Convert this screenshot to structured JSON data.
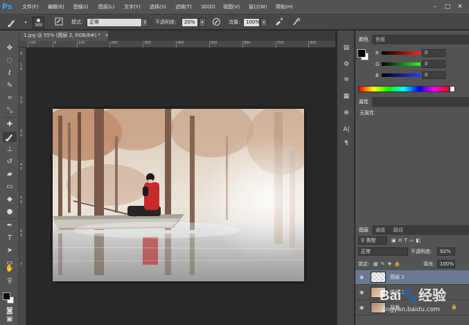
{
  "app": {
    "logo": "Ps",
    "accent": "#31a8ff"
  },
  "menu": {
    "items": [
      "文件(F)",
      "编辑(E)",
      "图像(I)",
      "图层(L)",
      "文字(Y)",
      "选择(S)",
      "滤镜(T)",
      "3D(D)",
      "视图(V)",
      "窗口(W)",
      "帮助(H)"
    ]
  },
  "window_controls": {
    "minimize": "–",
    "maximize": "□",
    "close": "✕"
  },
  "options": {
    "brush_size": "300",
    "mode_label": "模式:",
    "mode_value": "正常",
    "opacity_label": "不透明度:",
    "opacity_value": "20%",
    "flow_label": "流量:",
    "flow_value": "100%"
  },
  "document": {
    "tab_title": "1.jpg @ 55% (图层 2, RGB/8#) *",
    "tab_close": "×"
  },
  "ruler": {
    "h_labels": [
      "100",
      "0",
      "100",
      "200",
      "300",
      "400",
      "500",
      "600",
      "700",
      "800"
    ],
    "v_labels": [
      "0",
      "1",
      "0",
      "2",
      "0",
      "3",
      "0",
      "4",
      "0",
      "5",
      "0",
      "6",
      "0",
      "7"
    ]
  },
  "panels": {
    "color": {
      "tabs": [
        "颜色",
        "色板"
      ],
      "r_label": "R",
      "g_label": "G",
      "b_label": "B",
      "r_value": "0",
      "g_value": "0",
      "b_value": "0",
      "foreground": "#000000",
      "background": "#ffffff"
    },
    "properties": {
      "tab": "属性",
      "content": "无属性"
    },
    "layers": {
      "tabs": [
        "图层",
        "通道",
        "路径"
      ],
      "filter_value": "类型",
      "blend_mode": "正常",
      "opacity_label": "不透明度:",
      "opacity_value": "92%",
      "lock_label": "锁定:",
      "fill_label": "填充:",
      "fill_value": "100%",
      "rows": [
        {
          "name": "图层 2",
          "selected": true
        },
        {
          "name": "图层 1",
          "selected": false
        },
        {
          "name": "背景",
          "selected": false
        }
      ]
    }
  },
  "watermark": {
    "brand": "Bai",
    "brand2": "经验",
    "url": "jingyan.baidu.com"
  },
  "icons": {
    "brush": "brush-icon",
    "move": "move-icon",
    "marquee": "marquee-icon",
    "lasso": "lasso-icon",
    "quick_select": "quick-select-icon",
    "crop": "crop-icon",
    "eyedropper": "eyedropper-icon",
    "healing": "healing-icon",
    "stamp": "stamp-icon",
    "history": "history-brush-icon",
    "eraser": "eraser-icon",
    "gradient": "gradient-icon",
    "blur": "blur-icon",
    "dodge": "dodge-icon",
    "pen": "pen-icon",
    "type": "type-icon",
    "path_select": "path-select-icon",
    "shape": "rectangle-icon",
    "hand": "hand-icon",
    "zoom": "zoom-icon"
  }
}
